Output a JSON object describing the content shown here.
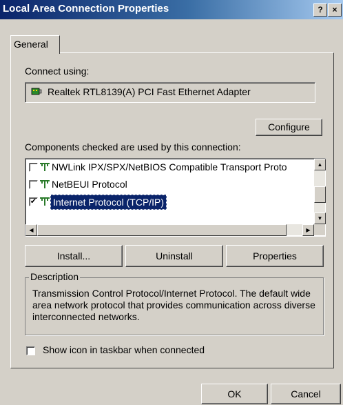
{
  "window": {
    "title": "Local Area Connection Properties",
    "help_label": "?",
    "close_label": "×"
  },
  "tabs": [
    {
      "label": "General",
      "selected": true
    }
  ],
  "connect_using": {
    "label": "Connect using:",
    "adapter": "Realtek RTL8139(A) PCI Fast Ethernet Adapter",
    "configure_label": "Configure"
  },
  "components": {
    "label": "Components checked are used by this connection:",
    "items": [
      {
        "label": "NWLink IPX/SPX/NetBIOS Compatible Transport Proto",
        "checked": false,
        "selected": false
      },
      {
        "label": "NetBEUI Protocol",
        "checked": false,
        "selected": false
      },
      {
        "label": "Internet Protocol (TCP/IP)",
        "checked": true,
        "selected": true
      }
    ]
  },
  "buttons": {
    "install": "Install...",
    "uninstall": "Uninstall",
    "properties": "Properties"
  },
  "description": {
    "label": "Description",
    "text": "Transmission Control Protocol/Internet Protocol. The default wide area network protocol that provides communication across diverse interconnected networks."
  },
  "show_icon": {
    "label": "Show icon in taskbar when connected",
    "checked": false
  },
  "footer": {
    "ok_label": "OK",
    "cancel_label": "Cancel"
  },
  "colors": {
    "title_start": "#0a246a",
    "title_end": "#a6caf0",
    "selection": "#0a246a",
    "face": "#d4d0c8"
  },
  "icons": {
    "adapter": "network-adapter-icon",
    "protocol": "network-protocol-icon"
  }
}
